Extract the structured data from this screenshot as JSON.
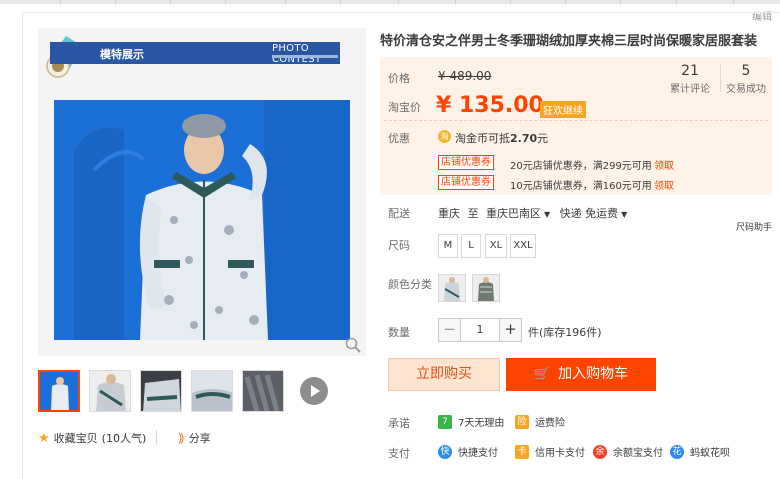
{
  "edit_link": "编辑",
  "gallery": {
    "banner_title": "模特展示",
    "banner_photo": "PHOTO CONTEST",
    "thumb_count": 5
  },
  "favorites": {
    "label": "收藏宝贝",
    "count": "(10人气)"
  },
  "share": {
    "label": "分享"
  },
  "product": {
    "title": "特价清仓安之伴男士冬季珊瑚绒加厚夹棉三层时尚保暖家居服套装"
  },
  "price": {
    "label": "价格",
    "original": "¥ 489.00",
    "sale_label": "淘宝价",
    "sale": "¥ 135.00",
    "sale_tag": "狂欢继续"
  },
  "stats": {
    "reviews_count": "21",
    "reviews_label": "累计评论",
    "sales_count": "5",
    "sales_label": "交易成功"
  },
  "promo": {
    "label": "优惠",
    "coin_icon": "淘",
    "coin_text_prefix": "淘金币可抵",
    "coin_amount": "2.70",
    "coin_unit": "元",
    "coupons": [
      {
        "tag": "店铺优惠券",
        "text": "20元店铺优惠券，满299元可用",
        "action": "领取"
      },
      {
        "tag": "店铺优惠券",
        "text": "10元店铺优惠券，满160元可用",
        "action": "领取"
      }
    ]
  },
  "delivery": {
    "label": "配送",
    "from": "重庆",
    "to_word": "至",
    "to": "重庆巴南区",
    "shipping": "快递 免运费"
  },
  "size": {
    "label": "尺码",
    "helper": "尺码助手",
    "options": [
      "M",
      "L",
      "XL",
      "XXL"
    ]
  },
  "color": {
    "label": "颜色分类"
  },
  "quantity": {
    "label": "数量",
    "minus": "−",
    "value": "1",
    "plus": "+",
    "stock": "件(库存196件)"
  },
  "buttons": {
    "buy": "立即购买",
    "cart": "加入购物车"
  },
  "commitment": {
    "label": "承诺",
    "items": [
      {
        "text": "7天无理由",
        "icon_char": "7",
        "color": "#39b54a"
      },
      {
        "text": "运费险",
        "icon_char": "险",
        "color": "#f5a623"
      }
    ]
  },
  "payment": {
    "label": "支付",
    "items": [
      {
        "text": "快捷支付",
        "icon_char": "快",
        "color": "#2e8cf0"
      },
      {
        "text": "信用卡支付",
        "icon_char": "卡",
        "color": "#f5a623"
      },
      {
        "text": "余额宝支付",
        "icon_char": "余",
        "color": "#f23f2a"
      },
      {
        "text": "蚂蚁花呗",
        "icon_char": "花",
        "color": "#2e8cf0"
      }
    ]
  },
  "colors": {
    "accent": "#ff4400",
    "price_bg": "#fff2e8",
    "banner": "#2a56a3",
    "photo_bg": "#1c6fd6"
  }
}
